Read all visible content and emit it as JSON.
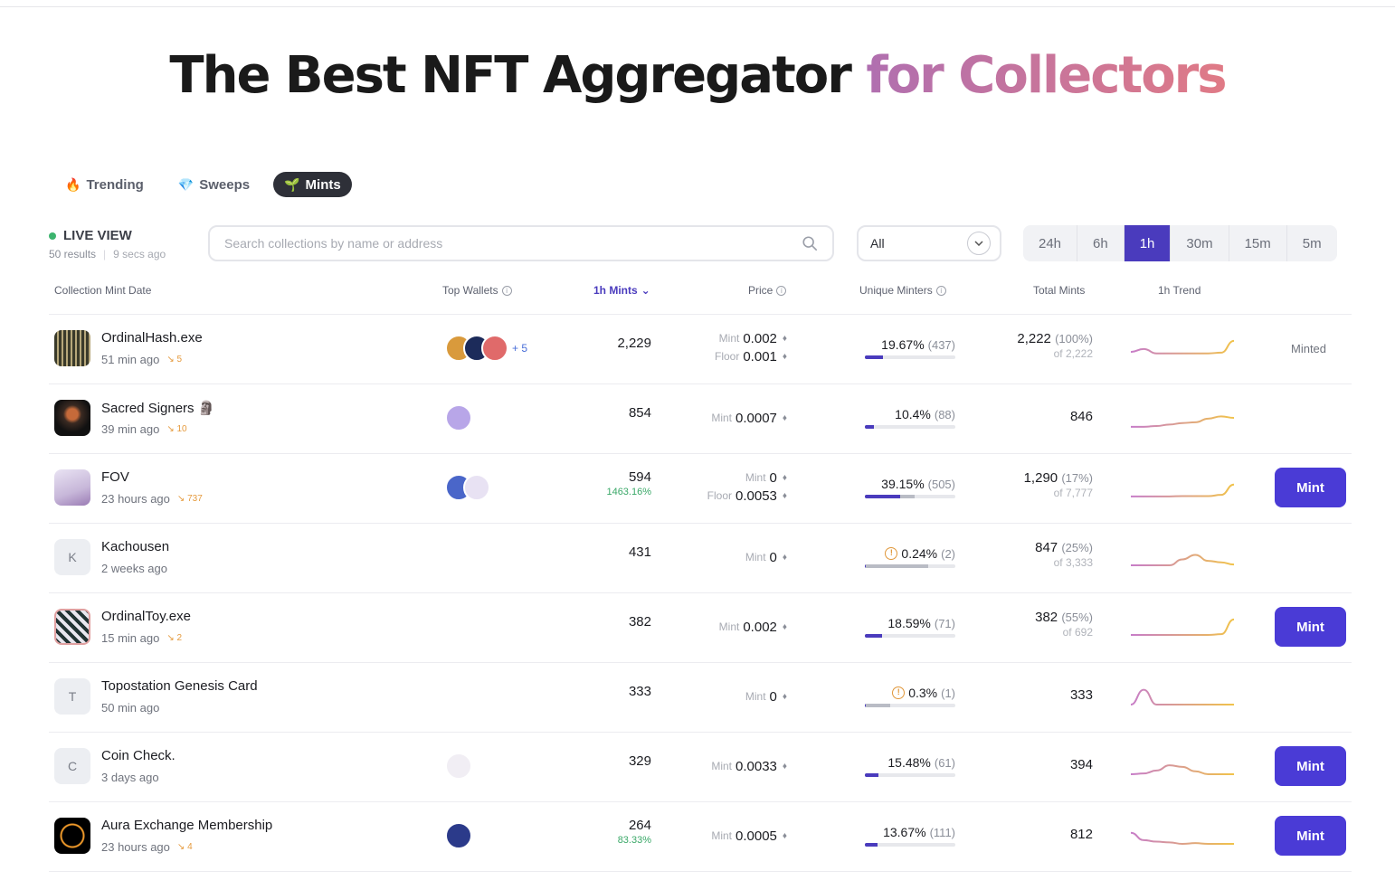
{
  "hero": {
    "title_main": "The Best NFT Aggregator",
    "title_accent": "for Collectors"
  },
  "tabs": [
    {
      "label": "Trending",
      "icon": "fire-icon",
      "active": false
    },
    {
      "label": "Sweeps",
      "icon": "gem-icon",
      "active": false
    },
    {
      "label": "Mints",
      "icon": "sprout-icon",
      "active": true
    }
  ],
  "live": {
    "label": "LIVE VIEW",
    "results": "50 results",
    "updated": "9 secs ago"
  },
  "search": {
    "placeholder": "Search collections by name or address"
  },
  "filter": {
    "selected": "All"
  },
  "timeframes": [
    {
      "label": "24h",
      "active": false
    },
    {
      "label": "6h",
      "active": false
    },
    {
      "label": "1h",
      "active": true
    },
    {
      "label": "30m",
      "active": false
    },
    {
      "label": "15m",
      "active": false
    },
    {
      "label": "5m",
      "active": false
    }
  ],
  "columns": {
    "collection": "Collection Mint Date",
    "wallets": "Top Wallets",
    "mints": "1h Mints",
    "price": "Price",
    "unique": "Unique Minters",
    "total": "Total Mints",
    "trend": "1h Trend"
  },
  "colors": {
    "accent": "#4a3bd6",
    "trend_start": "#c77dc9",
    "trend_end": "#f1c34a"
  },
  "rows": [
    {
      "name": "OrdinalHash.exe",
      "avatar": "pixel-grid",
      "ago": "51 min ago",
      "tx": "5",
      "wallets": 3,
      "wallets_more": "+ 5",
      "mints": "2,229",
      "mints_pct": "",
      "mint_price": "0.002",
      "floor_price": "0.001",
      "unique_pct": "19.67%",
      "unique_count": "(437)",
      "unique_fill": 0.2,
      "unique_gray": 0.2,
      "warn": false,
      "total": "2,222",
      "total_pct": "(100%)",
      "total_of": "of 2,222",
      "trend": [
        0.25,
        0.05,
        0.35,
        0.35,
        0.35,
        0.35,
        0.35,
        0.3,
        -0.5
      ],
      "action": "Minted"
    },
    {
      "name": "Sacred Signers 🗿",
      "avatar": "dark-art",
      "ago": "39 min ago",
      "tx": "10",
      "wallets": 1,
      "wallets_more": "",
      "mints": "854",
      "mints_pct": "",
      "mint_price": "0.0007",
      "floor_price": "",
      "unique_pct": "10.4%",
      "unique_count": "(88)",
      "unique_fill": 0.1,
      "unique_gray": 0.1,
      "warn": false,
      "total": "846",
      "total_pct": "",
      "total_of": "",
      "trend": [
        0.6,
        0.6,
        0.55,
        0.45,
        0.35,
        0.3,
        0.05,
        -0.1,
        0.0
      ],
      "action": ""
    },
    {
      "name": "FOV",
      "avatar": "anime",
      "ago": "23 hours ago",
      "tx": "737",
      "wallets": 2,
      "wallets_more": "",
      "mints": "594",
      "mints_pct": "1463.16%",
      "mint_price": "0",
      "floor_price": "0.0053",
      "unique_pct": "39.15%",
      "unique_count": "(505)",
      "unique_fill": 0.39,
      "unique_gray": 0.55,
      "warn": false,
      "total": "1,290",
      "total_pct": "(17%)",
      "total_of": "of 7,777",
      "trend": [
        0.6,
        0.6,
        0.6,
        0.6,
        0.58,
        0.58,
        0.58,
        0.5,
        -0.2
      ],
      "action": "Mint"
    },
    {
      "name": "Kachousen",
      "avatar": "K",
      "ago": "2 weeks ago",
      "tx": "",
      "wallets": 0,
      "wallets_more": "",
      "mints": "431",
      "mints_pct": "",
      "mint_price": "0",
      "floor_price": "",
      "unique_pct": "0.24%",
      "unique_count": "(2)",
      "unique_fill": 0.003,
      "unique_gray": 0.7,
      "warn": true,
      "total": "847",
      "total_pct": "(25%)",
      "total_of": "of 3,333",
      "trend": [
        0.55,
        0.55,
        0.55,
        0.55,
        0.15,
        -0.15,
        0.25,
        0.35,
        0.5
      ],
      "action": ""
    },
    {
      "name": "OrdinalToy.exe",
      "avatar": "toy",
      "ago": "15 min ago",
      "tx": "2",
      "wallets": 0,
      "wallets_more": "",
      "mints": "382",
      "mints_pct": "",
      "mint_price": "0.002",
      "floor_price": "",
      "unique_pct": "18.59%",
      "unique_count": "(71)",
      "unique_fill": 0.19,
      "unique_gray": 0.19,
      "warn": false,
      "total": "382",
      "total_pct": "(55%)",
      "total_of": "of 692",
      "trend": [
        0.55,
        0.55,
        0.55,
        0.55,
        0.55,
        0.55,
        0.55,
        0.5,
        -0.5
      ],
      "action": "Mint"
    },
    {
      "name": "Topostation Genesis Card",
      "avatar": "T",
      "ago": "50 min ago",
      "tx": "",
      "wallets": 0,
      "wallets_more": "",
      "mints": "333",
      "mints_pct": "",
      "mint_price": "0",
      "floor_price": "",
      "unique_pct": "0.3%",
      "unique_count": "(1)",
      "unique_fill": 0.003,
      "unique_gray": 0.28,
      "warn": true,
      "total": "333",
      "total_pct": "",
      "total_of": "",
      "trend": [
        0.55,
        -0.45,
        0.55,
        0.55,
        0.55,
        0.55,
        0.55,
        0.55,
        0.55
      ],
      "action": ""
    },
    {
      "name": "Coin Check.",
      "avatar": "C",
      "ago": "3 days ago",
      "tx": "",
      "wallets": 1,
      "wallets_more": "",
      "mints": "329",
      "mints_pct": "",
      "mint_price": "0.0033",
      "floor_price": "",
      "unique_pct": "15.48%",
      "unique_count": "(61)",
      "unique_fill": 0.15,
      "unique_gray": 0.15,
      "warn": false,
      "total": "394",
      "total_pct": "",
      "total_of": "",
      "trend": [
        0.55,
        0.5,
        0.3,
        -0.05,
        0.05,
        0.35,
        0.55,
        0.55,
        0.55
      ],
      "action": "Mint"
    },
    {
      "name": "Aura Exchange Membership",
      "avatar": "aura",
      "ago": "23 hours ago",
      "tx": "4",
      "wallets": 1,
      "wallets_more": "",
      "mints": "264",
      "mints_pct": "83.33%",
      "mint_price": "0.0005",
      "floor_price": "",
      "unique_pct": "13.67%",
      "unique_count": "(111)",
      "unique_fill": 0.14,
      "unique_gray": 0.14,
      "warn": false,
      "total": "812",
      "total_pct": "",
      "total_of": "",
      "trend": [
        -0.2,
        0.3,
        0.4,
        0.45,
        0.55,
        0.5,
        0.55,
        0.55,
        0.55
      ],
      "action": "Mint"
    }
  ]
}
